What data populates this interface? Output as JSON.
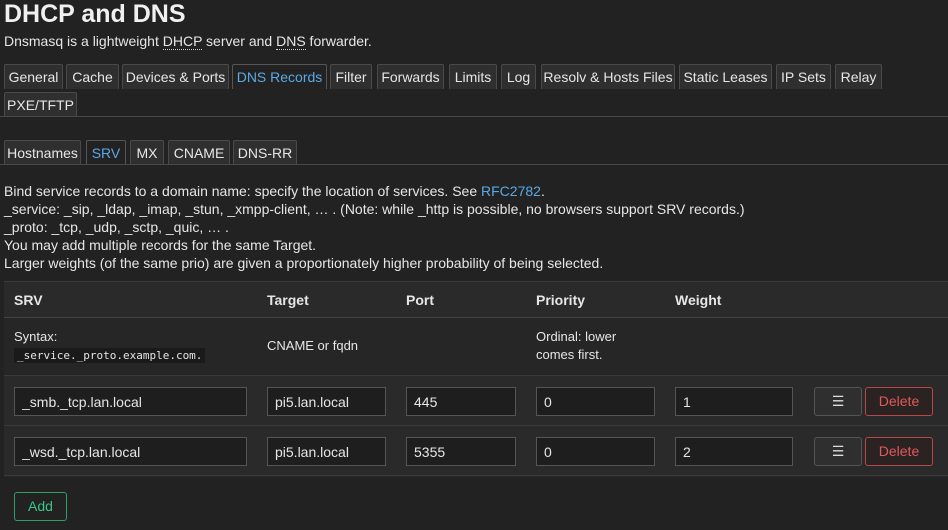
{
  "header": {
    "title": "DHCP and DNS",
    "desc_pre": "Dnsmasq is a lightweight ",
    "desc_abbr1": "DHCP",
    "desc_mid": " server and ",
    "desc_abbr2": "DNS",
    "desc_post": " forwarder."
  },
  "main_tabs": [
    {
      "label": "General"
    },
    {
      "label": "Cache"
    },
    {
      "label": "Devices & Ports"
    },
    {
      "label": "DNS Records"
    },
    {
      "label": "Filter"
    },
    {
      "label": "Forwards"
    },
    {
      "label": "Limits"
    },
    {
      "label": "Log"
    },
    {
      "label": "Resolv & Hosts Files"
    },
    {
      "label": "Static Leases"
    },
    {
      "label": "IP Sets"
    },
    {
      "label": "Relay"
    },
    {
      "label": "PXE/TFTP"
    }
  ],
  "main_tabs_active": "DNS Records",
  "sub_tabs": [
    {
      "label": "Hostnames"
    },
    {
      "label": "SRV"
    },
    {
      "label": "MX"
    },
    {
      "label": "CNAME"
    },
    {
      "label": "DNS-RR"
    }
  ],
  "sub_tabs_active": "SRV",
  "info": {
    "line1_pre": "Bind service records to a domain name: specify the location of services. See ",
    "line1_link": "RFC2782",
    "line1_post": ".",
    "line2": "_service: _sip, _ldap, _imap, _stun, _xmpp-client, … . (Note: while _http is possible, no browsers support SRV records.)",
    "line3": "_proto: _tcp, _udp, _sctp, _quic, … .",
    "line4": "You may add multiple records for the same Target.",
    "line5": "Larger weights (of the same prio) are given a proportionately higher probability of being selected."
  },
  "table": {
    "columns": [
      "SRV",
      "Target",
      "Port",
      "Priority",
      "Weight"
    ],
    "hint": {
      "srv_label": "Syntax:",
      "srv_code": "_service._proto.example.com.",
      "target": "CNAME or fqdn",
      "priority_1": "Ordinal: lower",
      "priority_2": "comes first."
    },
    "rows": [
      {
        "srv": "_smb._tcp.lan.local",
        "target": "pi5.lan.local",
        "port": "445",
        "priority": "0",
        "weight": "1"
      },
      {
        "srv": "_wsd._tcp.lan.local",
        "target": "pi5.lan.local",
        "port": "5355",
        "priority": "0",
        "weight": "2"
      }
    ],
    "menu_icon": "☰",
    "delete_label": "Delete"
  },
  "add_label": "Add"
}
